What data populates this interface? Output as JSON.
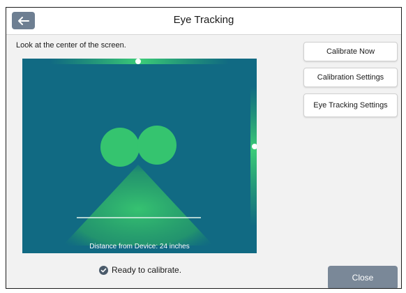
{
  "header": {
    "title": "Eye Tracking",
    "back_icon": "arrow-left-icon"
  },
  "instruction": "Look at the center of the screen.",
  "viewport": {
    "distance_label": "Distance from Device: 24 inches"
  },
  "side_buttons": {
    "calibrate_now": "Calibrate Now",
    "calibration_settings": "Calibration Settings",
    "eye_tracking_settings": "Eye Tracking Settings"
  },
  "status": {
    "text": "Ready to calibrate.",
    "icon": "check-circle-icon"
  },
  "footer": {
    "close_label": "Close"
  },
  "colors": {
    "viewport_bg": "#116a83",
    "eye_green": "#35c46f",
    "button_gray": "#7a8898"
  }
}
